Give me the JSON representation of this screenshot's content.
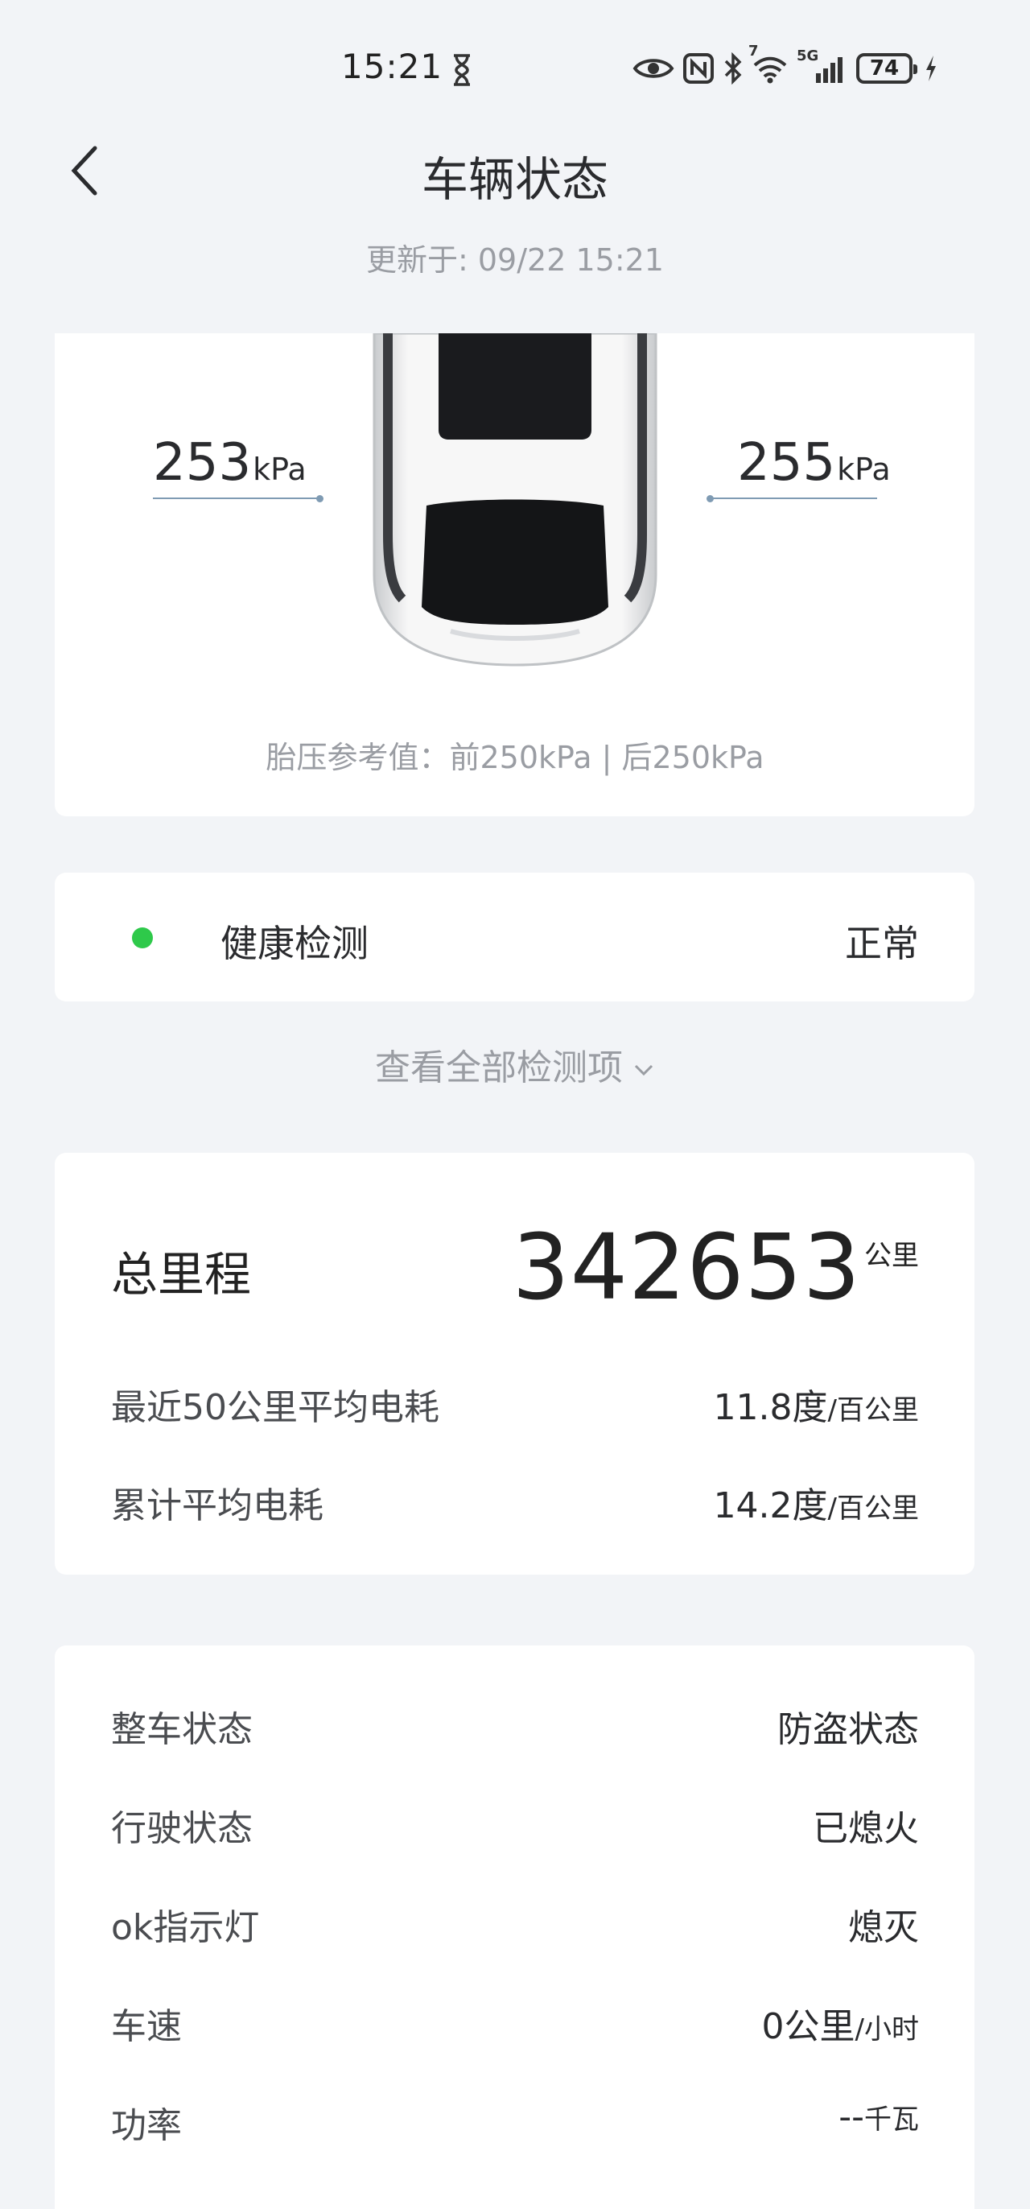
{
  "status_bar": {
    "time": "15:21",
    "icons": [
      "hourglass-icon",
      "eye-icon",
      "nfc-icon",
      "bluetooth-icon",
      "wifi-icon",
      "5g-signal-icon",
      "battery-icon",
      "charging-icon"
    ],
    "wifi_badge": "7",
    "network_label": "5G",
    "battery_level": "74"
  },
  "header": {
    "title": "车辆状态",
    "updated": "更新于: 09/22 15:21"
  },
  "tires": {
    "rear_left_value": "253",
    "rear_right_value": "255",
    "unit": "kPa",
    "reference": "胎压参考值：前250kPa | 后250kPa"
  },
  "health": {
    "label": "健康检测",
    "status": "正常",
    "status_color": "#2ec94a",
    "view_all": "查看全部检测项"
  },
  "mileage": {
    "total_label": "总里程",
    "total_value": "342653",
    "total_unit": "公里",
    "rows": [
      {
        "label": "最近50公里平均电耗",
        "value": "11.8度",
        "unit": "/百公里"
      },
      {
        "label": "累计平均电耗",
        "value": "14.2度",
        "unit": "/百公里"
      }
    ]
  },
  "vehicle_status": {
    "rows": [
      {
        "label": "整车状态",
        "value": "防盗状态",
        "unit": ""
      },
      {
        "label": "行驶状态",
        "value": "已熄火",
        "unit": ""
      },
      {
        "label": "ok指示灯",
        "value": "熄灭",
        "unit": ""
      },
      {
        "label": "车速",
        "value": "0公里",
        "unit": "/小时"
      },
      {
        "label": "功率",
        "value": "--",
        "unit": "千瓦"
      }
    ]
  }
}
